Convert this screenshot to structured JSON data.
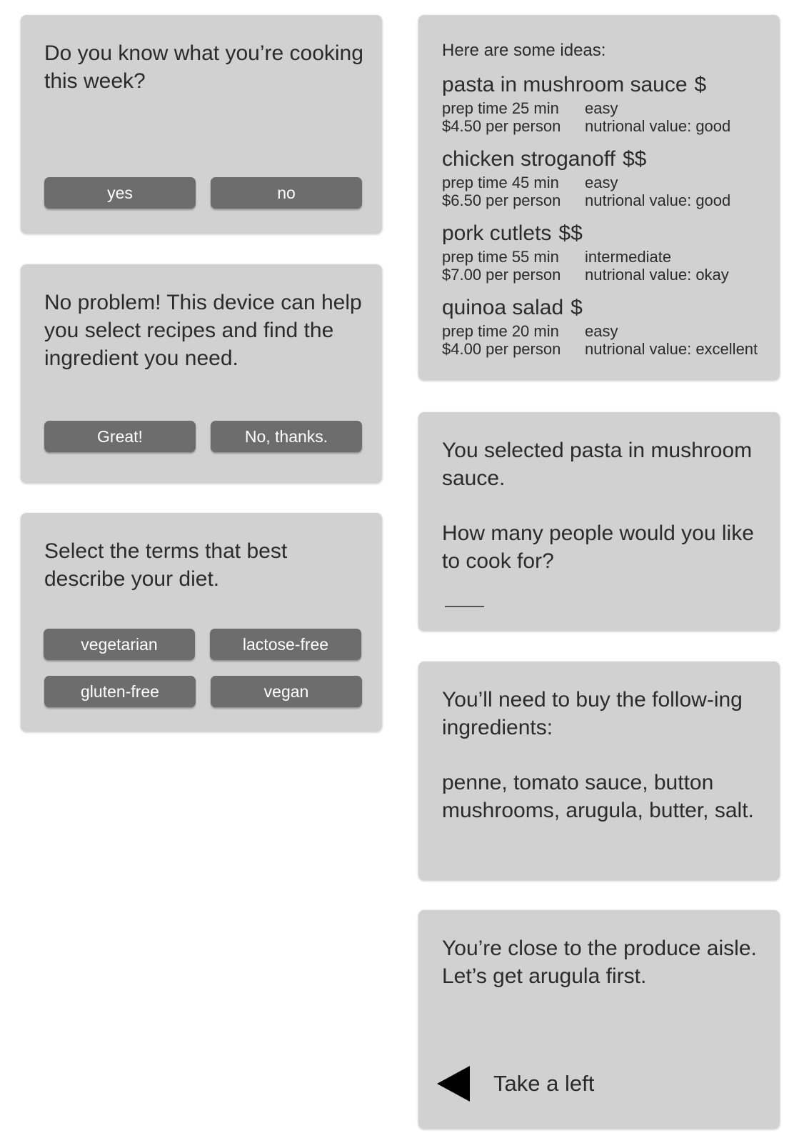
{
  "cooking_card": {
    "question": "Do you know what you’re cooking this week?",
    "yes_label": "yes",
    "no_label": "no"
  },
  "help_card": {
    "message": "No problem! This device can help you select recipes and find the ingredient you need.",
    "great_label": "Great!",
    "no_thanks_label": "No, thanks."
  },
  "diet_card": {
    "question": "Select the terms that best describe your diet.",
    "options": [
      "vegetarian",
      "lactose-free",
      "gluten-free",
      "vegan"
    ]
  },
  "ideas_card": {
    "heading": "Here are some ideas:",
    "recipes": [
      {
        "name": "pasta in mushroom sauce",
        "price_level": "$",
        "prep_time": "prep time 25 min",
        "difficulty": "easy",
        "cost": "$4.50 per person",
        "nutrition": "nutrional value: good"
      },
      {
        "name": "chicken stroganoff",
        "price_level": "$$",
        "prep_time": "prep time 45 min",
        "difficulty": "easy",
        "cost": "$6.50 per person",
        "nutrition": "nutrional value: good"
      },
      {
        "name": "pork cutlets",
        "price_level": "$$",
        "prep_time": "prep time 55 min",
        "difficulty": "intermediate",
        "cost": "$7.00 per person",
        "nutrition": "nutrional value: okay"
      },
      {
        "name": "quinoa salad",
        "price_level": "$",
        "prep_time": "prep time 20 min",
        "difficulty": "easy",
        "cost": "$4.00 per person",
        "nutrition": "nutrional value: excellent"
      }
    ]
  },
  "selected_card": {
    "selection": "You selected pasta in mushroom sauce.",
    "question": "How many people would you like to cook for?"
  },
  "buy_card": {
    "intro": "You’ll need to buy the follow-ing ingredients:",
    "ingredients": "penne, tomato sauce, button mushrooms, arugula, butter, salt."
  },
  "direction_card": {
    "message": "You’re close to the produce aisle. Let’s get arugula first.",
    "direction_label": "Take a left",
    "direction_icon": "arrow-left-icon"
  },
  "colors": {
    "card_background": "#d1d1d1",
    "button_background": "#6d6d6d",
    "button_text": "#ffffff",
    "text": "#2b2b2b"
  }
}
